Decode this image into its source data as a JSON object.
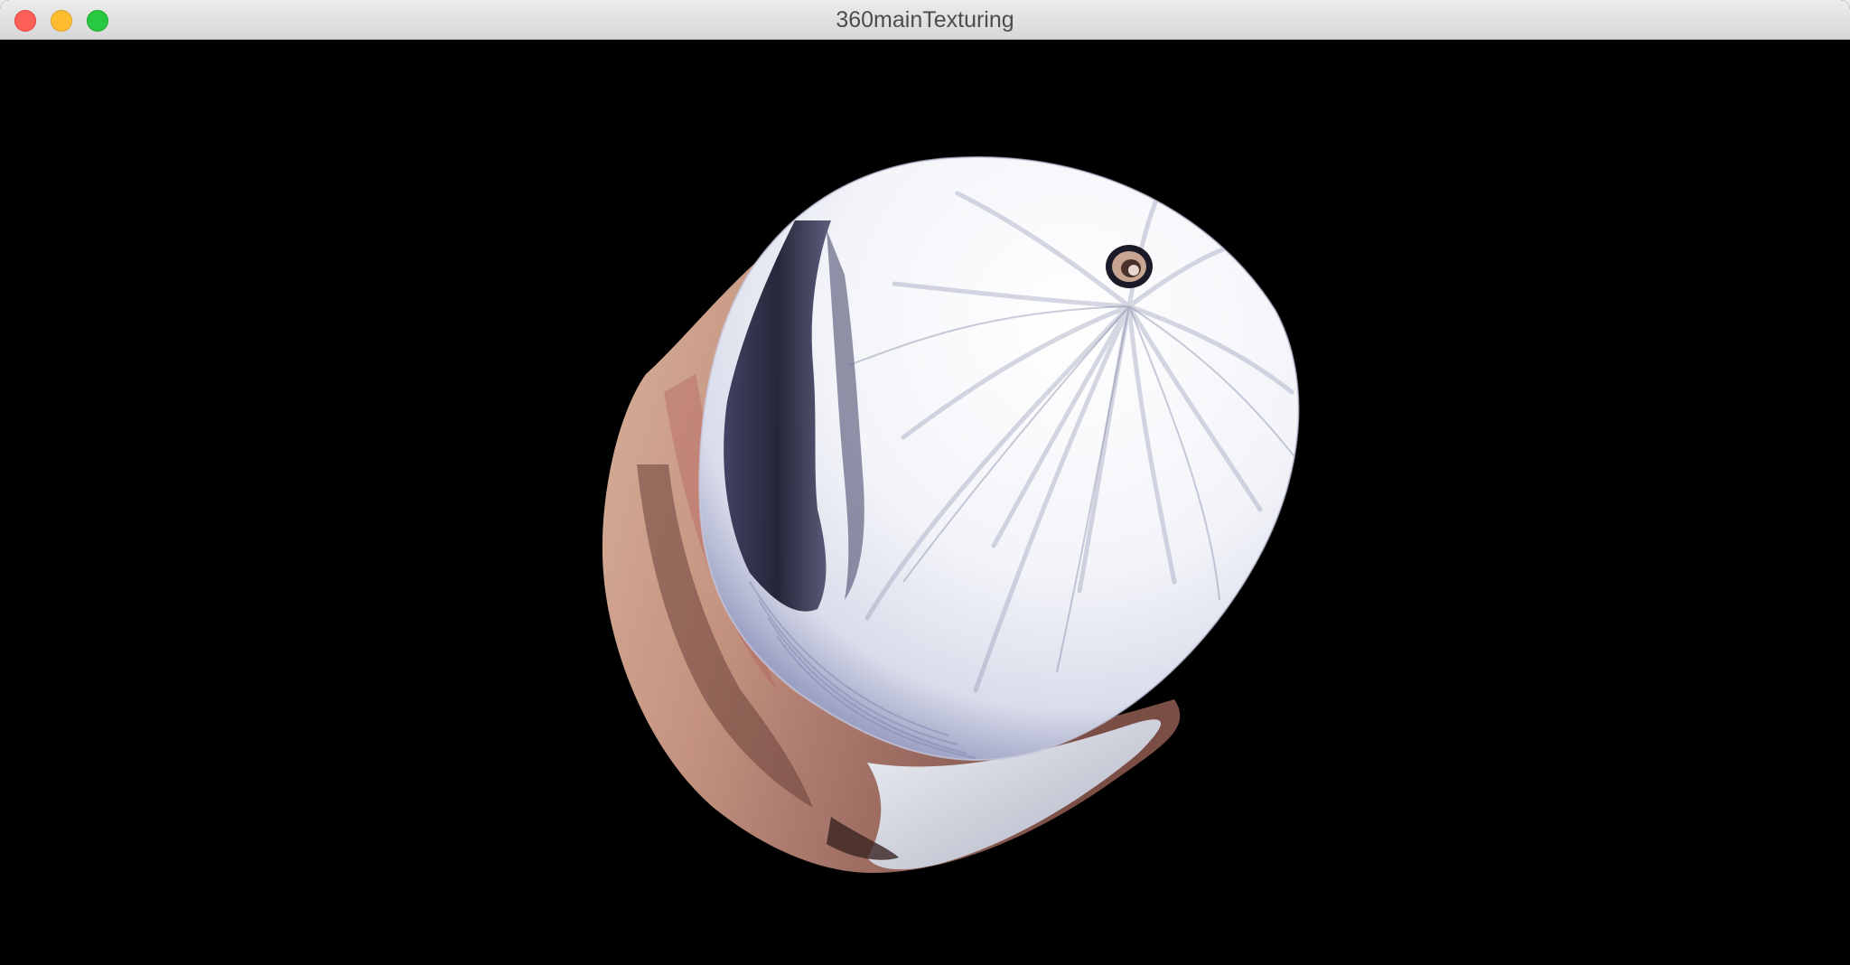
{
  "window": {
    "title": "360mainTexturing",
    "background_color": "#000000"
  },
  "traffic_lights": {
    "close_color": "#fe5f57",
    "minimize_color": "#febc2e",
    "zoom_color": "#28c840"
  },
  "scene": {
    "object": "textured cylinder",
    "palette": {
      "cap_white": "#f6f7fb",
      "cap_streak": "#8a8fae",
      "dark_fold": "#22223a",
      "skin_tone": "#c79a84",
      "skin_shadow": "#6a3f38",
      "grey_side": "#c8ccd8"
    }
  }
}
